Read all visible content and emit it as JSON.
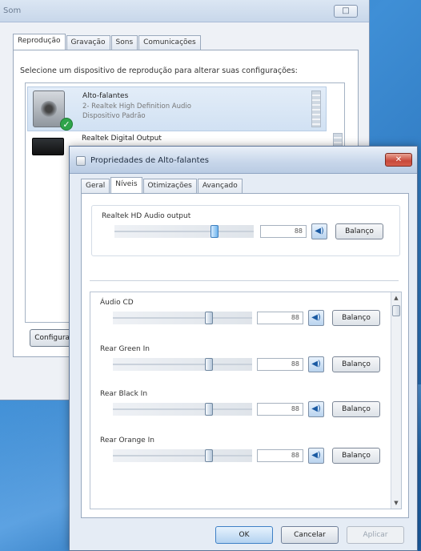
{
  "desktop": {},
  "som_window": {
    "title": "Som",
    "close_icon": "□",
    "tabs": [
      "Reprodução",
      "Gravação",
      "Sons",
      "Comunicações"
    ],
    "instruction": "Selecione um dispositivo de reprodução para alterar suas configurações:",
    "devices": [
      {
        "name": "Alto-falantes",
        "sub": "2- Realtek High Definition Audio",
        "state": "Dispositivo Padrão",
        "icon": "speaker-icon",
        "badge": "check-badge-icon"
      },
      {
        "name": "Realtek Digital Output",
        "icon": "digital-output-icon"
      }
    ],
    "configure_label": "Configurar"
  },
  "properties_window": {
    "title": "Propriedades de Alto-falantes",
    "close_label": "✕",
    "tabs": [
      "Geral",
      "Níveis",
      "Otimizações",
      "Avançado"
    ],
    "active_tab": "Níveis",
    "master": {
      "label": "Realtek HD Audio output",
      "value": "88",
      "level_fraction": 0.73,
      "balance_label": "Balanço",
      "mute_icon": "speaker-volume-icon"
    },
    "channels": [
      {
        "label": "Áudio CD",
        "value": "88",
        "level_fraction": 0.7,
        "balance_label": "Balanço"
      },
      {
        "label": "Rear Green In",
        "value": "88",
        "level_fraction": 0.7,
        "balance_label": "Balanço"
      },
      {
        "label": "Rear Black In",
        "value": "88",
        "level_fraction": 0.7,
        "balance_label": "Balanço"
      },
      {
        "label": "Rear Orange In",
        "value": "88",
        "level_fraction": 0.7,
        "balance_label": "Balanço"
      }
    ],
    "buttons": {
      "ok": "OK",
      "cancel": "Cancelar",
      "apply": "Aplicar"
    }
  },
  "colors": {
    "desktop_blue": "#2c73b8",
    "close_red": "#c8483a",
    "selection_blue": "#d1e1f3",
    "default_check_green": "#2fa44a"
  }
}
